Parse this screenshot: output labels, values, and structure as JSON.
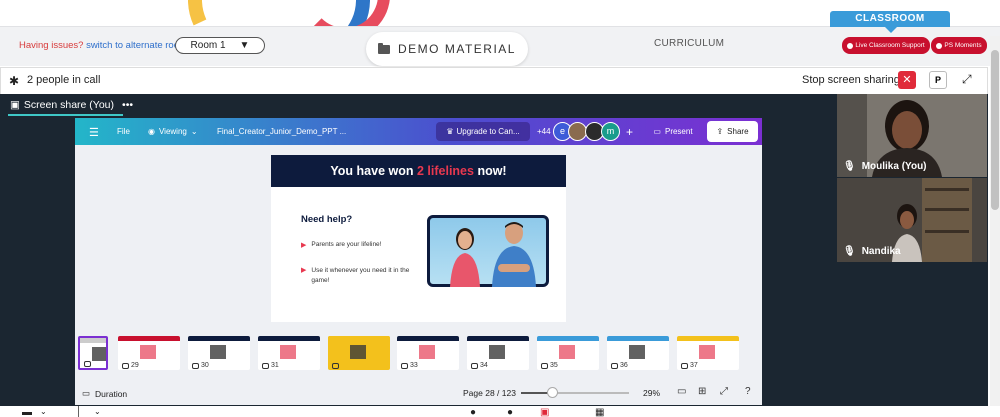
{
  "header": {
    "issues_text": "Having issues?",
    "switch_text": "switch to alternate room",
    "room_label": "Room 1",
    "demo_label": "DEMO MATERIAL",
    "curriculum_label": "CURRICULUM",
    "classroom_label": "CLASSROOM",
    "live_support_label": "Live Classroom Support",
    "ps_moments_label": "PS Moments"
  },
  "call": {
    "people_count_text": "2 people in call",
    "stop_share_label": "Stop screen sharing",
    "p_button_label": "P",
    "screen_share_tab": "Screen share (You)",
    "more_label": "•••"
  },
  "canva": {
    "file_label": "File",
    "viewing_label": "Viewing",
    "doc_title": "Final_Creator_Junior_Demo_PPT ...",
    "upgrade_label": "Upgrade to Can...",
    "extra_count": "+44",
    "avatar_e": "e",
    "avatar_m": "m",
    "plus_label": "+",
    "present_label": "Present",
    "share_label": "Share",
    "duration_label": "Duration",
    "page_info": "Page 28 / 123",
    "zoom_level": "29%"
  },
  "slide": {
    "title_pre": "You have won ",
    "title_highlight": "2 lifelines",
    "title_post": " now!",
    "need_help": "Need help?",
    "bullet1": "Parents are your lifeline!",
    "bullet2": "Use it whenever you need it in the game!"
  },
  "thumbnails": [
    {
      "num": ""
    },
    {
      "num": "29"
    },
    {
      "num": "30"
    },
    {
      "num": "31"
    },
    {
      "num": ""
    },
    {
      "num": "33"
    },
    {
      "num": "34"
    },
    {
      "num": "35"
    },
    {
      "num": "36"
    },
    {
      "num": "37"
    }
  ],
  "participants": [
    {
      "name": "Moulika (You)"
    },
    {
      "name": "Nandika"
    }
  ],
  "colors": {
    "accent_red": "#c8102e",
    "classroom_blue": "#3a9bd9",
    "canva_gradient_start": "#23b6c9",
    "canva_gradient_end": "#7b2fd2",
    "slide_navy": "#0d1b3d",
    "highlight_red": "#e8384f"
  }
}
